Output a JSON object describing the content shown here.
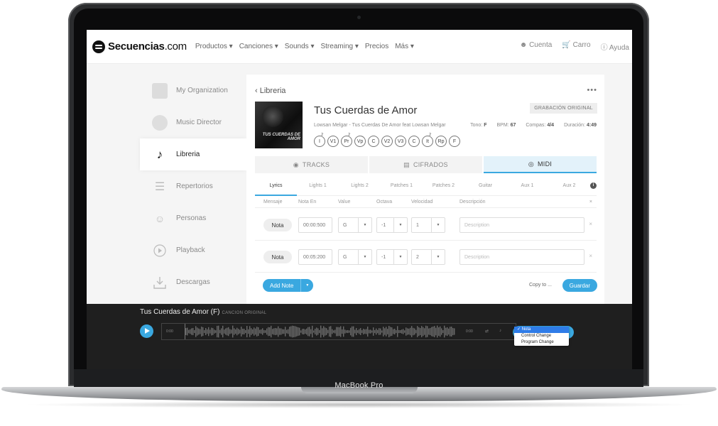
{
  "device": {
    "model": "MacBook Pro"
  },
  "nav": {
    "logo_bold": "Secuencias",
    "logo_suffix": ".com",
    "links": [
      "Productos ▾",
      "Canciones ▾",
      "Sounds ▾",
      "Streaming ▾",
      "Precios",
      "Más ▾"
    ],
    "cuenta": "Cuenta",
    "carro": "Carro",
    "ayuda": "Ayuda"
  },
  "sidebar": {
    "items": [
      {
        "label": "My Organization",
        "icon": "organization-icon",
        "active": false
      },
      {
        "label": "Music Director",
        "icon": "music-director-icon",
        "active": false
      },
      {
        "label": "Libreria",
        "icon": "music-note-icon",
        "active": true
      },
      {
        "label": "Repertorios",
        "icon": "setlist-icon",
        "active": false
      },
      {
        "label": "Personas",
        "icon": "people-icon",
        "active": false
      },
      {
        "label": "Playback",
        "icon": "play-circle-icon",
        "active": false
      },
      {
        "label": "Descargas",
        "icon": "download-icon",
        "active": false
      }
    ]
  },
  "song": {
    "back_label": "Libreria",
    "more": "•••",
    "cover_text": "TUS CUERDAS DE AMOR",
    "title": "Tus Cuerdas de Amor",
    "badge": "GRABACIÓN ORIGINAL",
    "subtitle": "Lowsan Melgar - Tus Cuerdas De Amor feat Lowsan Melgar",
    "tono_label": "Tono:",
    "tono": "F",
    "bpm_label": "BPM:",
    "bpm": "67",
    "compas_label": "Compas:",
    "compas": "4/4",
    "duracion_label": "Duración:",
    "duracion": "4:49",
    "sections": [
      {
        "label": "I",
        "sup": "2"
      },
      {
        "label": "V1",
        "sup": ""
      },
      {
        "label": "Pr",
        "sup": "2"
      },
      {
        "label": "Vp",
        "sup": ""
      },
      {
        "label": "C",
        "sup": ""
      },
      {
        "label": "V2",
        "sup": ""
      },
      {
        "label": "V3",
        "sup": ""
      },
      {
        "label": "C",
        "sup": ""
      },
      {
        "label": "It",
        "sup": "2"
      },
      {
        "label": "Rp",
        "sup": ""
      },
      {
        "label": "F",
        "sup": ""
      }
    ]
  },
  "tabs": [
    "TRACKS",
    "CIFRADOS",
    "MIDI"
  ],
  "subtabs": [
    "Lyrics",
    "Lights 1",
    "Lights 2",
    "Patches 1",
    "Patches 2",
    "Guitar",
    "Aux 1",
    "Aux 2"
  ],
  "columns": {
    "mensaje": "Mensaje",
    "nota_en": "Nota En",
    "value": "Value",
    "octava": "Octava",
    "velocidad": "Velocidad",
    "descripcion": "Descripción",
    "close": "×"
  },
  "rows": [
    {
      "type": "Nota",
      "time": "00:00:500",
      "value": "G",
      "octave": "-1",
      "velocity": "1",
      "description_placeholder": "Description"
    },
    {
      "type": "Nota",
      "time": "00:05:200",
      "value": "G",
      "octave": "-1",
      "velocity": "2",
      "description_placeholder": "Description"
    }
  ],
  "actions": {
    "add_note": "Add Note",
    "copy_to": "Copy to ...",
    "guardar": "Guardar"
  },
  "player": {
    "title": "Tus Cuerdas de Amor (F)",
    "tag": "CANCION ORIGINAL",
    "time_start": "0:00",
    "time_end": "0:00",
    "menu": [
      "Nota",
      "Control Change",
      "Program Change"
    ],
    "menu_selected": "Nota"
  },
  "colors": {
    "accent": "#3aa8e0",
    "player_bg": "#1f1f1f"
  }
}
